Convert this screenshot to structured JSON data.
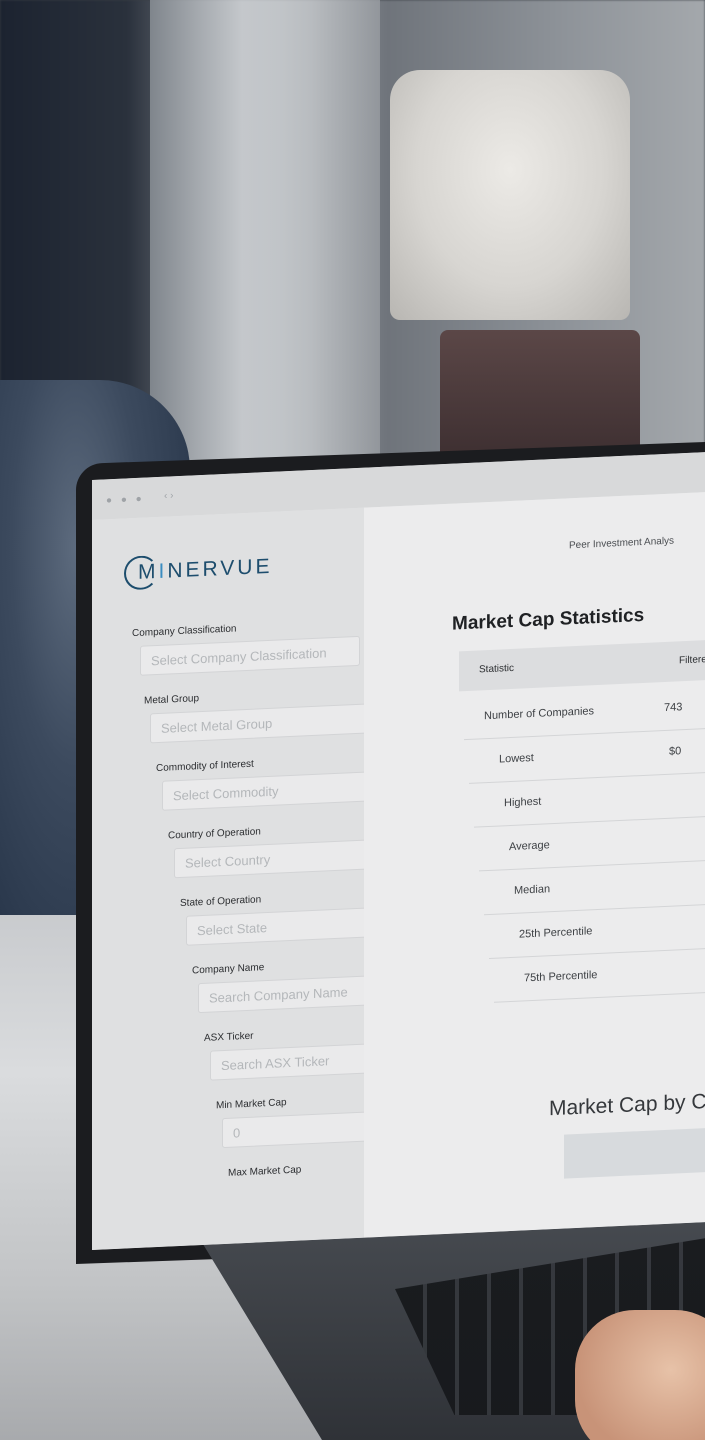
{
  "logo": {
    "pre": "M",
    "accent": "I",
    "post": "NERVUE"
  },
  "header": {
    "title": "Peer Investment Analys"
  },
  "sidebar": {
    "fields": [
      {
        "label": "Company Classification",
        "placeholder": "Select Company Classification"
      },
      {
        "label": "Metal Group",
        "placeholder": "Select Metal Group"
      },
      {
        "label": "Commodity of Interest",
        "placeholder": "Select Commodity"
      },
      {
        "label": "Country of Operation",
        "placeholder": "Select Country"
      },
      {
        "label": "State of Operation",
        "placeholder": "Select State"
      },
      {
        "label": "Company Name",
        "placeholder": "Search Company Name"
      },
      {
        "label": "ASX Ticker",
        "placeholder": "Search ASX Ticker"
      },
      {
        "label": "Min Market Cap",
        "placeholder": "0"
      },
      {
        "label": "Max Market Cap",
        "placeholder": ""
      }
    ]
  },
  "main": {
    "title": "Market Cap Statistics",
    "table": {
      "headers": [
        "Statistic",
        "Filtere"
      ],
      "rows": [
        {
          "stat": "Number of Companies",
          "value": "743"
        },
        {
          "stat": "Lowest",
          "value": "$0"
        },
        {
          "stat": "Highest",
          "value": ""
        },
        {
          "stat": "Average",
          "value": ""
        },
        {
          "stat": "Median",
          "value": ""
        },
        {
          "stat": "25th Percentile",
          "value": ""
        },
        {
          "stat": "75th Percentile",
          "value": ""
        }
      ]
    },
    "subtitle": "Market Cap by Classif"
  },
  "window": {
    "dots": "● ● ●",
    "nav": "‹ ›"
  },
  "colors": {
    "brand": "#1d4d6d",
    "brand_accent": "#3a8cc0"
  }
}
